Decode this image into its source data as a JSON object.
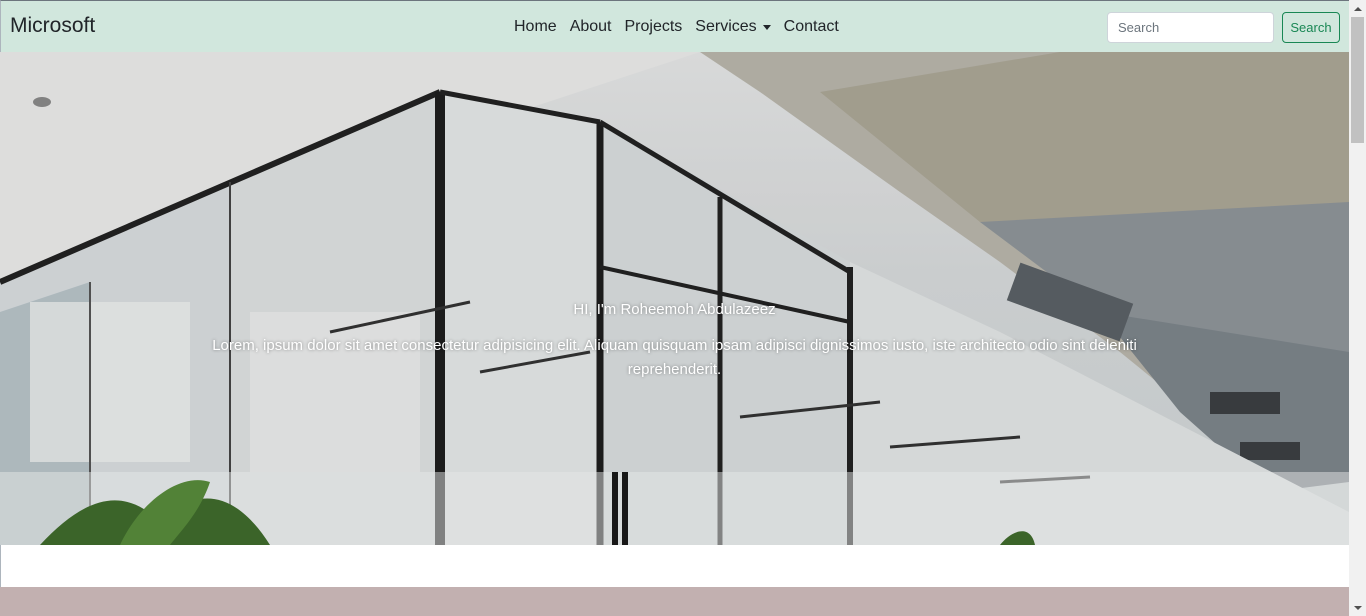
{
  "navbar": {
    "brand": "Microsoft",
    "links": [
      "Home",
      "About",
      "Projects",
      "Services",
      "Contact"
    ],
    "search_placeholder": "Search",
    "search_button": "Search",
    "background": "#d1e7dd"
  },
  "hero": {
    "title": "HI, I'm Roheemoh Abdulazeez",
    "text": "Lorem, ipsum dolor sit amet consectetur adipisicing elit. Aliquam quisquam ipsam adipisci dignissimos iusto, iste architecto odio sint deleniti reprehenderit."
  },
  "colors": {
    "accent": "#198754",
    "footer_band": "#c2b0b0"
  }
}
